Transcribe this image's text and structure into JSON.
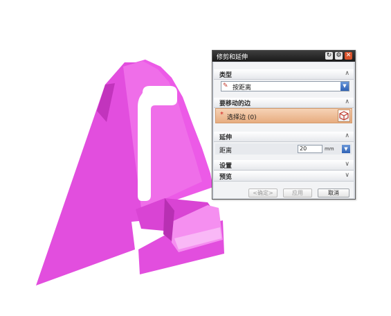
{
  "dialog": {
    "title": "修剪和延伸",
    "title_buttons": {
      "reset": "↻",
      "settings": "⚙",
      "close": "✕"
    },
    "sections": {
      "type": {
        "label": "类型",
        "chevron": "∧"
      },
      "edges": {
        "label": "要移动的边",
        "chevron": "∧"
      },
      "extend": {
        "label": "延伸",
        "chevron": "∧"
      },
      "settings": {
        "label": "设置",
        "chevron": "∨"
      },
      "preview": {
        "label": "预览",
        "chevron": "∨"
      }
    },
    "type_select": {
      "icon": "distance-icon",
      "value": "按距离"
    },
    "select_edge": {
      "required_mark": "*",
      "label": "选择边 (0)",
      "icon": "cube-icon"
    },
    "distance": {
      "label": "距离",
      "value": "20",
      "unit": "mm"
    },
    "buttons": {
      "ok": "<确定>",
      "apply": "应用",
      "cancel": "取消"
    }
  },
  "colors": {
    "model_magenta": "#e64ee0",
    "model_light": "#f58ff0",
    "model_dark": "#b830b3",
    "titlebar": "#1a1a1a",
    "selection_orange": "#e7ac7f"
  }
}
